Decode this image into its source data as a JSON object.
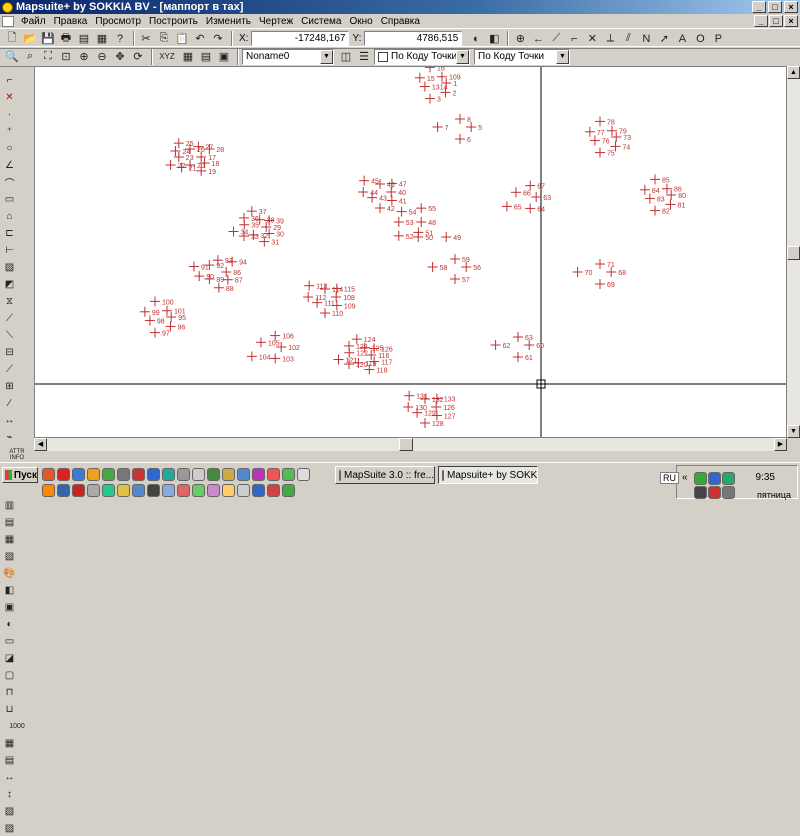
{
  "window": {
    "title": "Mapsuite+ by SOKKIA BV - [маппорт в тах]",
    "controls": {
      "minimize": "_",
      "maximize": "□",
      "close": "×"
    }
  },
  "menu": [
    "Файл",
    "Правка",
    "Просмотр",
    "Построить",
    "Изменить",
    "Чертеж",
    "Система",
    "Окно",
    "Справка"
  ],
  "coords": {
    "x_label": "X:",
    "x_value": "-17248,167",
    "y_label": "Y:",
    "y_value": "4786,515"
  },
  "snap_letters": [
    "N",
    "A",
    "O",
    "P"
  ],
  "toolbar2": {
    "xyz_label": "XYZ",
    "layer_value": "Noname0",
    "point_code_check": "По Коду Точки",
    "point_code_combo": "По Коду Точки"
  },
  "side_labels": {
    "attr": "ATTR INFO",
    "num": "1000"
  },
  "canvas": {
    "line_color": "#000000",
    "point_color": "#c03030",
    "crosshair_xy": [
      "-17248,167",
      "4786,515"
    ],
    "points": [
      [
        "1",
        "2",
        "3",
        "1314",
        "15",
        "16",
        "109"
      ],
      [
        "5",
        "6",
        "7",
        "8"
      ],
      [
        "17",
        "18",
        "19",
        "20",
        "21",
        "22",
        "23",
        "24",
        "25",
        "26",
        "27",
        "28"
      ],
      [
        "40",
        "41",
        "42",
        "43",
        "44",
        "45",
        "46",
        "47"
      ],
      [
        "48",
        "51",
        "52",
        "53",
        "54",
        "55"
      ],
      [
        "63",
        "64",
        "65",
        "66",
        "67"
      ],
      [
        "73",
        "74",
        "75",
        "76",
        "77",
        "78",
        "79"
      ],
      [
        "80",
        "81",
        "82",
        "83",
        "84",
        "85",
        "86"
      ],
      [
        "29",
        "30",
        "31",
        "32",
        "33",
        "34",
        "35",
        "36",
        "37",
        "38",
        "39"
      ],
      [
        "49",
        "50"
      ],
      [
        "56",
        "57",
        "58",
        "59"
      ],
      [
        "68",
        "69",
        "70",
        "71"
      ],
      [
        "86",
        "87",
        "88",
        "89",
        "90",
        "91",
        "92",
        "93",
        "94"
      ],
      [
        "108",
        "109",
        "110",
        "111",
        "112",
        "113",
        "114",
        "115"
      ],
      [
        "95",
        "96",
        "97",
        "98",
        "99",
        "100",
        "101"
      ],
      [
        "102",
        "103",
        "104",
        "105",
        "106"
      ],
      [
        "116",
        "117",
        "118",
        "119",
        "120",
        "121",
        "122",
        "123",
        "124",
        "125",
        "126"
      ],
      [
        "60",
        "61",
        "62",
        "63"
      ],
      [
        "126",
        "127",
        "128",
        "129",
        "130",
        "131",
        "132",
        "133"
      ]
    ]
  },
  "taskbar": {
    "start": "Пуск",
    "tasks": [
      {
        "label": "MapSuite 3.0 :: fre...",
        "active": false
      },
      {
        "label": "Mapsuite+ by SOKK...",
        "active": true
      }
    ],
    "lang": "RU",
    "time": "9:35",
    "day": "пятница"
  },
  "colors": {
    "title_start": "#0a246a",
    "title_end": "#a6caf0",
    "face": "#d4d0c8",
    "canvas": "#ffffff",
    "marker": "#c03030"
  }
}
